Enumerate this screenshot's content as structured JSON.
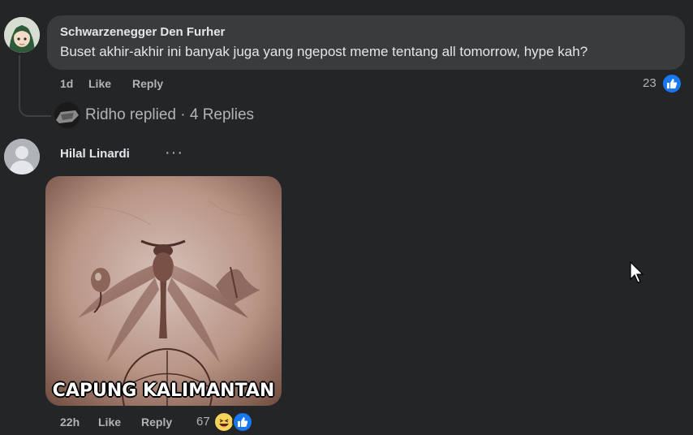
{
  "comment1": {
    "author": "Schwarzenegger Den Furher",
    "text": "Buset akhir-akhir ini banyak juga yang ngepost meme tentang all tomorrow, hype kah?",
    "time": "1d",
    "like_label": "Like",
    "reply_label": "Reply",
    "reaction_count": "23",
    "reactions": [
      "like-icon"
    ],
    "replies_summary": "Ridho replied · 4 Replies"
  },
  "comment2": {
    "author": "Hilal Linardi",
    "more_label": "···",
    "image_caption": "CAPUNG KALIMANTAN",
    "time": "22h",
    "like_label": "Like",
    "reply_label": "Reply",
    "reaction_count": "67",
    "reactions": [
      "haha-icon",
      "like-icon"
    ]
  },
  "colors": {
    "background": "#242526",
    "bubble": "#3a3b3c",
    "primary_text": "#e4e6eb",
    "secondary_text": "#b0b3b8",
    "like_blue": "#1877f2"
  }
}
